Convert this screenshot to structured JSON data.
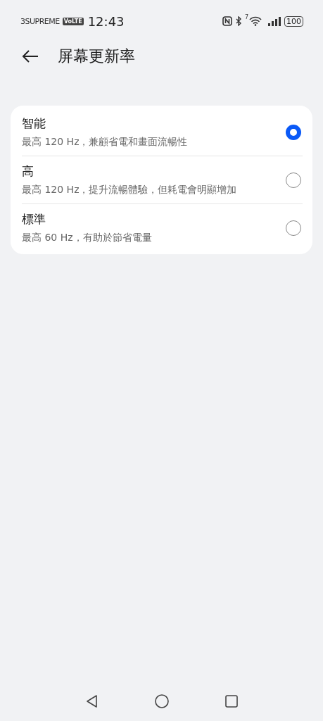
{
  "status_bar": {
    "carrier": "3SUPREME",
    "volte": "VoLTE",
    "time": "12:43",
    "wifi_standard": "7",
    "battery": "100"
  },
  "header": {
    "title": "屏幕更新率"
  },
  "options": [
    {
      "title": "智能",
      "description": "最高 120 Hz，兼顧省電和畫面流暢性",
      "selected": true
    },
    {
      "title": "高",
      "description": "最高 120 Hz，提升流暢體驗，但耗電會明顯增加",
      "selected": false
    },
    {
      "title": "標準",
      "description": "最高 60 Hz，有助於節省電量",
      "selected": false
    }
  ]
}
